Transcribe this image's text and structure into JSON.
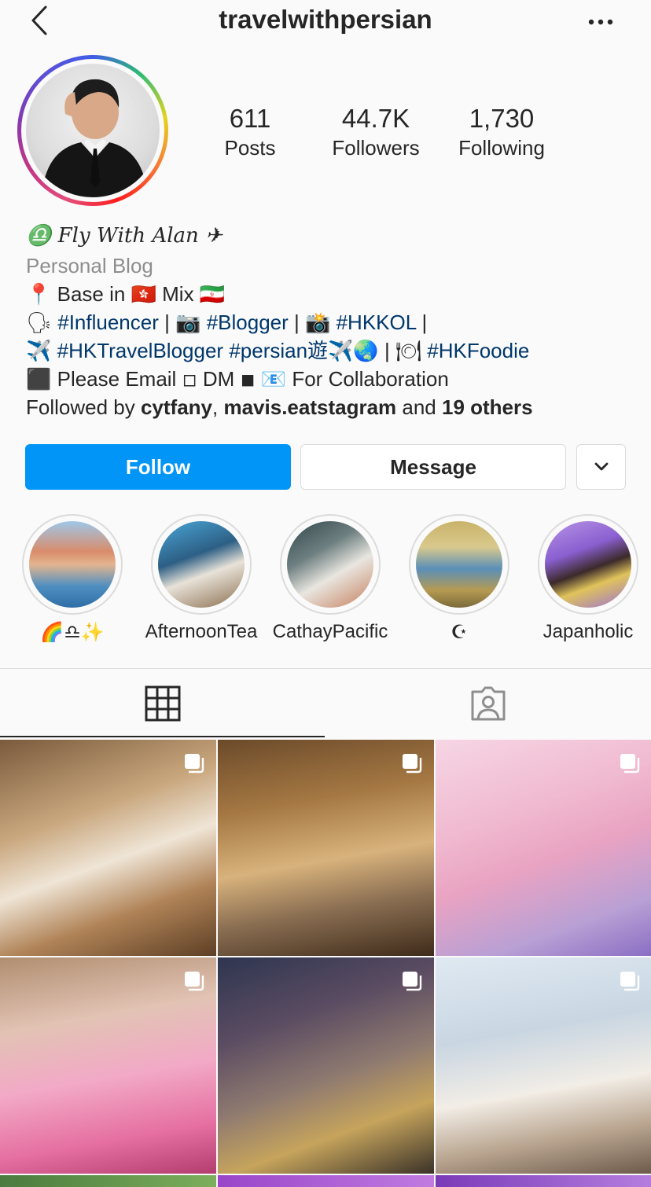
{
  "header": {
    "username": "travelwithpersian",
    "back_icon": "chevron-left-icon",
    "more_icon": "ellipsis-icon"
  },
  "stats": {
    "posts_count": "611",
    "posts_label": "Posts",
    "followers_count": "44.7K",
    "followers_label": "Followers",
    "following_count": "1,730",
    "following_label": "Following"
  },
  "bio": {
    "libra_glyph": "♎",
    "display_name": "𝐹𝑙𝑦 𝑊𝑖𝑡ℎ 𝐴𝑙𝑎𝑛",
    "plane_glyph": "✈",
    "category": "Personal Blog",
    "line1": "📍 Base in 🇭🇰 Mix 🇮🇷",
    "line2_a": "🗣 ",
    "line2_tag1": "#Influencer",
    "line2_b": "  | 📷 ",
    "line2_tag2": "#Blogger",
    "line2_c": " |  📸 ",
    "line2_tag3": "#HKKOL",
    "line2_d": " |",
    "line3_a": "✈️ ",
    "line3_tag1": "#HKTravelBlogger",
    "line3_b": " ",
    "line3_tag2": "#persian遊",
    "line3_c": "✈️🌏 | 🍽 ",
    "line3_tag3": "#HKFoodie",
    "line4": "⬛ Please Email ◽ DM ◾ 📧 For Collaboration",
    "followed_by_prefix": "Followed by ",
    "followed_by_user1": "cytfany",
    "followed_by_sep": ", ",
    "followed_by_user2": "mavis.eatstagram",
    "followed_by_and": " and ",
    "followed_by_others": "19 others"
  },
  "actions": {
    "follow_label": "Follow",
    "message_label": "Message",
    "dropdown_icon": "chevron-down-icon"
  },
  "highlights": [
    {
      "label": "🌈♎✨"
    },
    {
      "label": "AfternoonTea"
    },
    {
      "label": "CathayPacific"
    },
    {
      "label": "☪"
    },
    {
      "label": "Japanholic"
    }
  ],
  "tabs": {
    "grid_icon": "grid-icon",
    "tagged_icon": "tagged-person-icon"
  },
  "colors": {
    "accent": "#0095f6",
    "text": "#262626",
    "secondary_text": "#8e8e8e",
    "hashtag": "#00376b",
    "border": "#dbdbdb",
    "background": "#fafafa"
  }
}
